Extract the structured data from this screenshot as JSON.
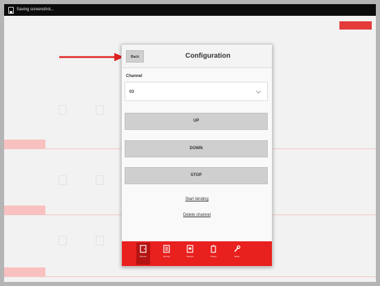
{
  "statusbar": {
    "text": "Saving screenshot..."
  },
  "dialog": {
    "back_label": "Back",
    "title": "Configuration",
    "channel_label": "Channel",
    "channel_value": "03",
    "buttons": [
      {
        "label": "UP"
      },
      {
        "label": "DOWN"
      },
      {
        "label": "STOP"
      }
    ],
    "links": [
      {
        "label": "Start binding"
      },
      {
        "label": "Delete channel"
      }
    ],
    "footer_items": [
      {
        "label": "Rooms",
        "icon": "door-icon"
      },
      {
        "label": "Groups",
        "icon": "group-icon"
      },
      {
        "label": "Scenes",
        "icon": "scene-icon"
      },
      {
        "label": "Timers",
        "icon": "timer-icon"
      },
      {
        "label": "Setup",
        "icon": "wrench-icon"
      }
    ]
  },
  "colors": {
    "accent": "#e8201e",
    "accent_dark": "#b41412",
    "arrow": "#e02020"
  }
}
